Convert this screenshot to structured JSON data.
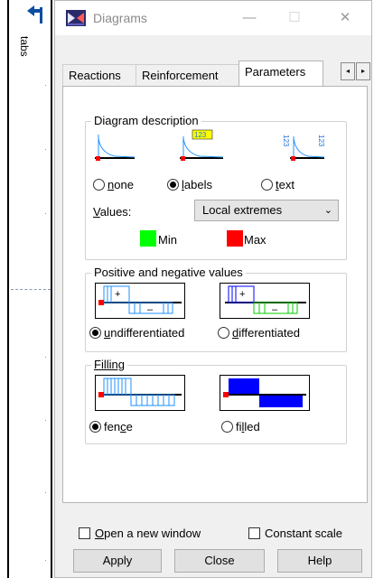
{
  "side_panel": {
    "tabs_label": "tabs"
  },
  "window": {
    "title": "Diagrams",
    "minimize": "—",
    "maximize": "☐",
    "close": "✕"
  },
  "tabs": [
    {
      "label": "Reactions",
      "active": false
    },
    {
      "label": "Reinforcement",
      "active": false
    },
    {
      "label": "Parameters",
      "active": true
    }
  ],
  "tab_scroll": {
    "left": "◂",
    "right": "▸"
  },
  "diagram_description": {
    "title": "Diagram description",
    "options": [
      {
        "label": "none",
        "mnemonic": "n",
        "rest": "one",
        "selected": false
      },
      {
        "label": "labels",
        "mnemonic": "l",
        "rest": "abels",
        "selected": true
      },
      {
        "label": "text",
        "mnemonic": "t",
        "rest": "ext",
        "selected": false
      }
    ],
    "values_label": "Values:",
    "values_mnemonic": "V",
    "values_rest": "alues:",
    "values_selected": "Local extremes",
    "icon_label_text": "123",
    "min_label": "Min",
    "max_label": "Max",
    "min_color": "#00ff00",
    "max_color": "#ff0000"
  },
  "pos_neg": {
    "title": "Positive and negative values",
    "options": [
      {
        "label": "undifferentiated",
        "mnemonic": "u",
        "rest": "ndifferentiated",
        "selected": true
      },
      {
        "label": "differentiated",
        "mnemonic": "d",
        "rest": "ifferentiated",
        "selected": false
      }
    ]
  },
  "filling": {
    "title": "Filling",
    "options": [
      {
        "label": "fence",
        "before": "fen",
        "mnemonic": "c",
        "after": "e",
        "selected": true
      },
      {
        "label": "filled",
        "before": "fi",
        "mnemonic": "l",
        "after": "led",
        "selected": false
      }
    ]
  },
  "checkboxes": {
    "open_new_window": {
      "mnemonic": "O",
      "rest": "pen a new window",
      "checked": false
    },
    "constant_scale": {
      "label": "Constant scale",
      "checked": false
    }
  },
  "buttons": {
    "apply": "Apply",
    "close": "Close",
    "help": "Help"
  },
  "colors": {
    "accent_blue": "#0078d7",
    "fill_blue": "#0000ff",
    "line_blue": "#1e90ff",
    "green": "#00ff00",
    "red": "#ff0000"
  }
}
